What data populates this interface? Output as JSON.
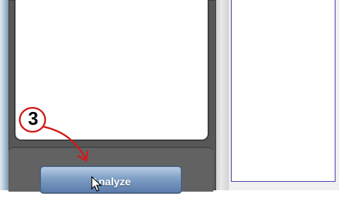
{
  "step_annotation": {
    "number": "3",
    "color": "#d11a1a"
  },
  "analyze_button": {
    "label": "Analyze"
  },
  "colors": {
    "panel_dark": "#575757",
    "button_blue": "#7f9fc5",
    "right_pane_border": "#3a3aa8"
  },
  "icons": [
    "mouse-cursor-icon",
    "arrow-annotation-icon"
  ]
}
